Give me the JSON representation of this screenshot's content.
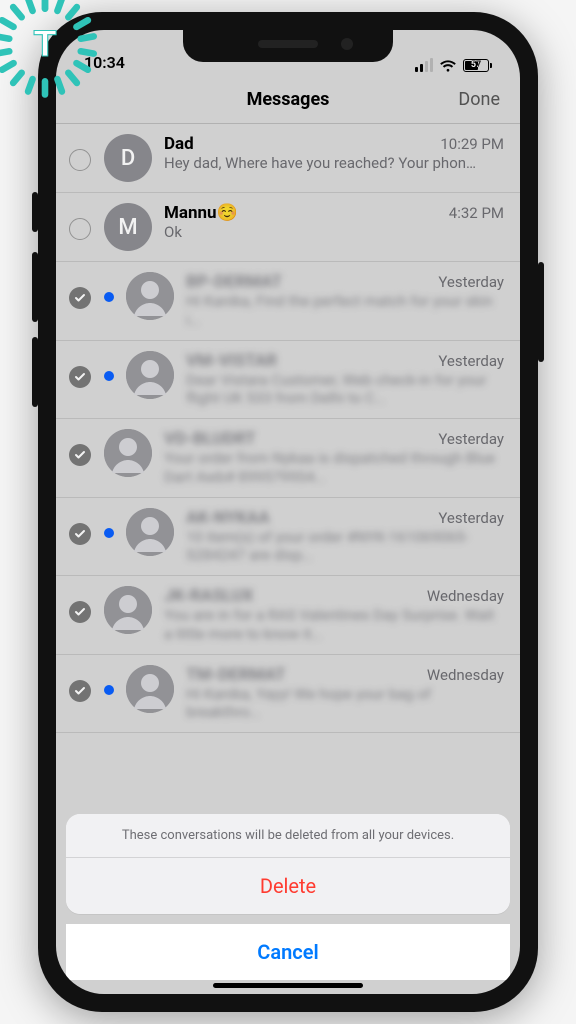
{
  "status": {
    "time": "10:34",
    "battery": "57"
  },
  "navbar": {
    "title": "Messages",
    "done": "Done"
  },
  "sheet": {
    "message": "These conversations will be deleted from all your devices.",
    "delete": "Delete",
    "cancel": "Cancel"
  },
  "conversations": [
    {
      "selected": false,
      "unread": false,
      "avatar_type": "initial",
      "initial": "D",
      "name": "Dad",
      "time": "10:29 PM",
      "preview": "Hey dad,\nWhere have you reached? Your phon…",
      "blurred": false
    },
    {
      "selected": false,
      "unread": false,
      "avatar_type": "initial",
      "initial": "M",
      "name": "Mannu☺️",
      "time": "4:32 PM",
      "preview": "Ok",
      "blurred": false
    },
    {
      "selected": true,
      "unread": true,
      "avatar_type": "generic",
      "initial": "",
      "name": "BP-DERMAT",
      "time": "Yesterday",
      "preview": "Hi Kanika,\nFind the perfect match for your skin i…",
      "blurred": true
    },
    {
      "selected": true,
      "unread": true,
      "avatar_type": "generic",
      "initial": "",
      "name": "VM-VISTAR",
      "time": "Yesterday",
      "preview": "Dear Vistara Customer, Web check-in for your flight UK 533 from Delhi to C…",
      "blurred": true
    },
    {
      "selected": true,
      "unread": false,
      "avatar_type": "generic",
      "initial": "",
      "name": "VD-BLUDRT",
      "time": "Yesterday",
      "preview": "Your order from Nykaa is dispatched through Blue Dart Awb# 8995799S4…",
      "blurred": true
    },
    {
      "selected": true,
      "unread": true,
      "avatar_type": "generic",
      "initial": "",
      "name": "AK-NYKAA",
      "time": "Yesterday",
      "preview": "10 item(s) of your order #NYK-161069065-S284247 are disp…",
      "blurred": true
    },
    {
      "selected": true,
      "unread": false,
      "avatar_type": "generic",
      "initial": "",
      "name": "JK-RASLUX",
      "time": "Wednesday",
      "preview": "You are in for a RAS Valentines Day Surprise. Wait a little more to know it…",
      "blurred": true
    },
    {
      "selected": true,
      "unread": true,
      "avatar_type": "generic",
      "initial": "",
      "name": "TM-DERMAT",
      "time": "Wednesday",
      "preview": "Hi Kanika,\nYayy! We hope your bag of breakthro…",
      "blurred": true
    }
  ]
}
